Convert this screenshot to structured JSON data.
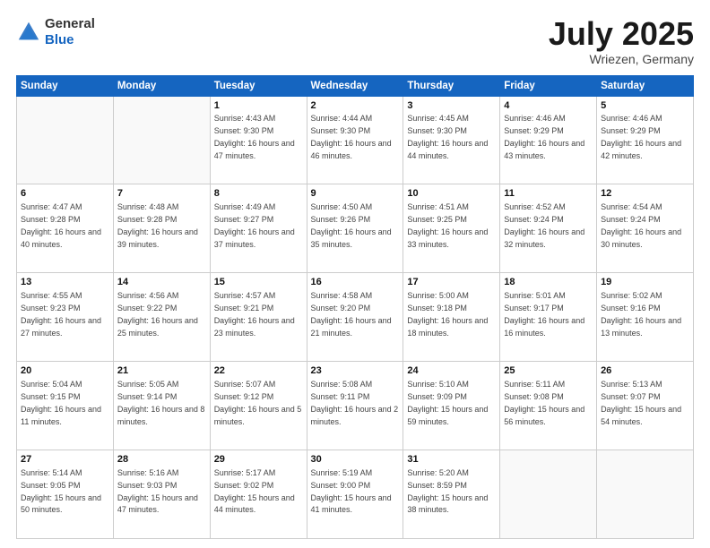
{
  "header": {
    "logo_line1": "General",
    "logo_line2": "Blue",
    "title": "July 2025",
    "location": "Wriezen, Germany"
  },
  "weekdays": [
    "Sunday",
    "Monday",
    "Tuesday",
    "Wednesday",
    "Thursday",
    "Friday",
    "Saturday"
  ],
  "weeks": [
    [
      {
        "day": "",
        "info": ""
      },
      {
        "day": "",
        "info": ""
      },
      {
        "day": "1",
        "info": "Sunrise: 4:43 AM\nSunset: 9:30 PM\nDaylight: 16 hours and 47 minutes."
      },
      {
        "day": "2",
        "info": "Sunrise: 4:44 AM\nSunset: 9:30 PM\nDaylight: 16 hours and 46 minutes."
      },
      {
        "day": "3",
        "info": "Sunrise: 4:45 AM\nSunset: 9:30 PM\nDaylight: 16 hours and 44 minutes."
      },
      {
        "day": "4",
        "info": "Sunrise: 4:46 AM\nSunset: 9:29 PM\nDaylight: 16 hours and 43 minutes."
      },
      {
        "day": "5",
        "info": "Sunrise: 4:46 AM\nSunset: 9:29 PM\nDaylight: 16 hours and 42 minutes."
      }
    ],
    [
      {
        "day": "6",
        "info": "Sunrise: 4:47 AM\nSunset: 9:28 PM\nDaylight: 16 hours and 40 minutes."
      },
      {
        "day": "7",
        "info": "Sunrise: 4:48 AM\nSunset: 9:28 PM\nDaylight: 16 hours and 39 minutes."
      },
      {
        "day": "8",
        "info": "Sunrise: 4:49 AM\nSunset: 9:27 PM\nDaylight: 16 hours and 37 minutes."
      },
      {
        "day": "9",
        "info": "Sunrise: 4:50 AM\nSunset: 9:26 PM\nDaylight: 16 hours and 35 minutes."
      },
      {
        "day": "10",
        "info": "Sunrise: 4:51 AM\nSunset: 9:25 PM\nDaylight: 16 hours and 33 minutes."
      },
      {
        "day": "11",
        "info": "Sunrise: 4:52 AM\nSunset: 9:24 PM\nDaylight: 16 hours and 32 minutes."
      },
      {
        "day": "12",
        "info": "Sunrise: 4:54 AM\nSunset: 9:24 PM\nDaylight: 16 hours and 30 minutes."
      }
    ],
    [
      {
        "day": "13",
        "info": "Sunrise: 4:55 AM\nSunset: 9:23 PM\nDaylight: 16 hours and 27 minutes."
      },
      {
        "day": "14",
        "info": "Sunrise: 4:56 AM\nSunset: 9:22 PM\nDaylight: 16 hours and 25 minutes."
      },
      {
        "day": "15",
        "info": "Sunrise: 4:57 AM\nSunset: 9:21 PM\nDaylight: 16 hours and 23 minutes."
      },
      {
        "day": "16",
        "info": "Sunrise: 4:58 AM\nSunset: 9:20 PM\nDaylight: 16 hours and 21 minutes."
      },
      {
        "day": "17",
        "info": "Sunrise: 5:00 AM\nSunset: 9:18 PM\nDaylight: 16 hours and 18 minutes."
      },
      {
        "day": "18",
        "info": "Sunrise: 5:01 AM\nSunset: 9:17 PM\nDaylight: 16 hours and 16 minutes."
      },
      {
        "day": "19",
        "info": "Sunrise: 5:02 AM\nSunset: 9:16 PM\nDaylight: 16 hours and 13 minutes."
      }
    ],
    [
      {
        "day": "20",
        "info": "Sunrise: 5:04 AM\nSunset: 9:15 PM\nDaylight: 16 hours and 11 minutes."
      },
      {
        "day": "21",
        "info": "Sunrise: 5:05 AM\nSunset: 9:14 PM\nDaylight: 16 hours and 8 minutes."
      },
      {
        "day": "22",
        "info": "Sunrise: 5:07 AM\nSunset: 9:12 PM\nDaylight: 16 hours and 5 minutes."
      },
      {
        "day": "23",
        "info": "Sunrise: 5:08 AM\nSunset: 9:11 PM\nDaylight: 16 hours and 2 minutes."
      },
      {
        "day": "24",
        "info": "Sunrise: 5:10 AM\nSunset: 9:09 PM\nDaylight: 15 hours and 59 minutes."
      },
      {
        "day": "25",
        "info": "Sunrise: 5:11 AM\nSunset: 9:08 PM\nDaylight: 15 hours and 56 minutes."
      },
      {
        "day": "26",
        "info": "Sunrise: 5:13 AM\nSunset: 9:07 PM\nDaylight: 15 hours and 54 minutes."
      }
    ],
    [
      {
        "day": "27",
        "info": "Sunrise: 5:14 AM\nSunset: 9:05 PM\nDaylight: 15 hours and 50 minutes."
      },
      {
        "day": "28",
        "info": "Sunrise: 5:16 AM\nSunset: 9:03 PM\nDaylight: 15 hours and 47 minutes."
      },
      {
        "day": "29",
        "info": "Sunrise: 5:17 AM\nSunset: 9:02 PM\nDaylight: 15 hours and 44 minutes."
      },
      {
        "day": "30",
        "info": "Sunrise: 5:19 AM\nSunset: 9:00 PM\nDaylight: 15 hours and 41 minutes."
      },
      {
        "day": "31",
        "info": "Sunrise: 5:20 AM\nSunset: 8:59 PM\nDaylight: 15 hours and 38 minutes."
      },
      {
        "day": "",
        "info": ""
      },
      {
        "day": "",
        "info": ""
      }
    ]
  ]
}
